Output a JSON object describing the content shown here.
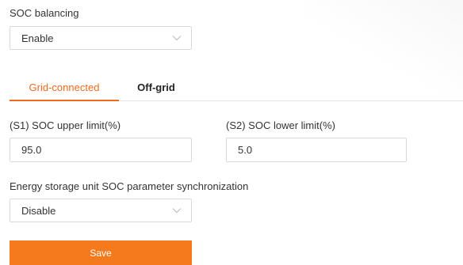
{
  "soc_balancing": {
    "label": "SOC balancing",
    "value": "Enable"
  },
  "tabs": [
    {
      "label": "Grid-connected",
      "active": true
    },
    {
      "label": "Off-grid",
      "active": false
    }
  ],
  "soc_upper": {
    "label": "(S1) SOC upper limit(%)",
    "value": "95.0"
  },
  "soc_lower": {
    "label": "(S2) SOC lower limit(%)",
    "value": "5.0"
  },
  "sync": {
    "label": "Energy storage unit SOC parameter synchronization",
    "value": "Disable"
  },
  "save_label": "Save",
  "colors": {
    "accent": "#f06a1d",
    "button": "#f57a1e",
    "border": "#d9d9d9"
  },
  "icons": {
    "dropdown": "chevron-down-icon"
  }
}
